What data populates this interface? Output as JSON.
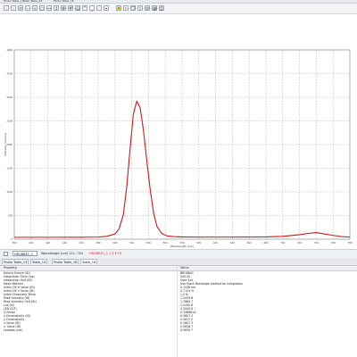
{
  "window": {
    "top_tabs": [
      "Photo Table_13",
      "Peak Table_24",
      "Photo Table_16"
    ]
  },
  "toolbar": {
    "buttons": [
      "back-icon",
      "forward-icon",
      "list-icon",
      "zoom-out-icon",
      "zoom-in-icon",
      "zoom-fit-icon",
      "zoom-x-icon",
      "zoom-y-icon",
      "pan-icon",
      "grid-icon",
      "stack-icon",
      "peak-icon",
      "baseline-icon",
      "marker-icon",
      "cursor-icon",
      "lightbulb-icon",
      "pin-icon",
      "copy-icon",
      "export-icon",
      "settings-icon",
      "table-icon",
      "print-icon"
    ]
  },
  "statusbar": {
    "dataset": "HRGBBE1_1",
    "coordinates": "Wavelength (nm) 111, 744",
    "label": "HRGBBE1_1 1.5 E+9",
    "accent": "#e03030"
  },
  "tabs": [
    {
      "label": "Photo Table_13",
      "active": false
    },
    {
      "label": "Table_14",
      "active": false
    },
    {
      "label": "Photo Table_18",
      "active": false
    },
    {
      "label": "Table_16",
      "active": true
    }
  ],
  "table": {
    "columns": [
      "Property",
      "Value"
    ],
    "rows": [
      {
        "property": "Device Source (ID)",
        "value": "BRC8800"
      },
      {
        "property": "Integration Time (ms)",
        "value": "200.00"
      },
      {
        "property": "Integration Unit (ID)",
        "value": "Over Ext"
      },
      {
        "property": "Mean Method",
        "value": "Use Glock Rectangle method for integration"
      },
      {
        "property": "Initial CIE X Value (ID)",
        "value": "0.1246 nm"
      },
      {
        "property": "Initial CIE Y Value (ID)",
        "value": "0.7124 %"
      },
      {
        "property": "Initial Chromatic Temp",
        "value": "1.2 N"
      },
      {
        "property": "Peak Intensity (ID)",
        "value": "1.2459 B"
      },
      {
        "property": "Peak Intensity Unit (ID)",
        "value": "1.7869 7"
      },
      {
        "property": "Lux (lx)",
        "value": "1.2445 8"
      },
      {
        "property": "LED (E/F)",
        "value": "3.2009 8"
      },
      {
        "property": "Q Factor",
        "value": "0.3368614"
      },
      {
        "property": "x Chromaticity (ID)",
        "value": "0.3807 3"
      },
      {
        "property": "y Chromaticity",
        "value": "0.5617 2"
      },
      {
        "property": "u Value (ID)",
        "value": "0.1807 3"
      },
      {
        "property": "v' Value (ID)",
        "value": "0.5626 7"
      },
      {
        "property": "Lambda (nm)",
        "value": "0.5659 7"
      }
    ]
  },
  "chart_data": {
    "type": "line",
    "title": "",
    "xlabel": "Wavelength (nm)",
    "ylabel": "Intensity (counts)",
    "xlim": [
      380,
      780
    ],
    "ylim": [
      0,
      4000
    ],
    "grid": true,
    "x_ticks": [
      "380",
      "400",
      "420",
      "440",
      "460",
      "480",
      "500",
      "520",
      "540",
      "560",
      "580",
      "600",
      "620",
      "640",
      "660",
      "680",
      "700",
      "720",
      "740",
      "760",
      "780"
    ],
    "y_ticks": [
      "0",
      "500",
      "1000",
      "1500",
      "2000",
      "2500",
      "3000",
      "3500",
      "4000"
    ],
    "series": [
      {
        "color": "#d01818",
        "x": [
          380,
          420,
          460,
          480,
          490,
          500,
          505,
          510,
          514,
          518,
          522,
          526,
          530,
          534,
          538,
          542,
          546,
          550,
          556,
          562,
          570,
          580,
          600,
          640,
          680,
          700,
          720,
          730,
          740,
          750,
          760,
          770,
          780
        ],
        "y": [
          40,
          40,
          42,
          45,
          60,
          110,
          220,
          520,
          1100,
          1900,
          2650,
          2920,
          2780,
          2300,
          1650,
          1050,
          560,
          270,
          120,
          70,
          55,
          48,
          45,
          45,
          48,
          60,
          95,
          120,
          140,
          110,
          80,
          55,
          45
        ]
      }
    ]
  }
}
